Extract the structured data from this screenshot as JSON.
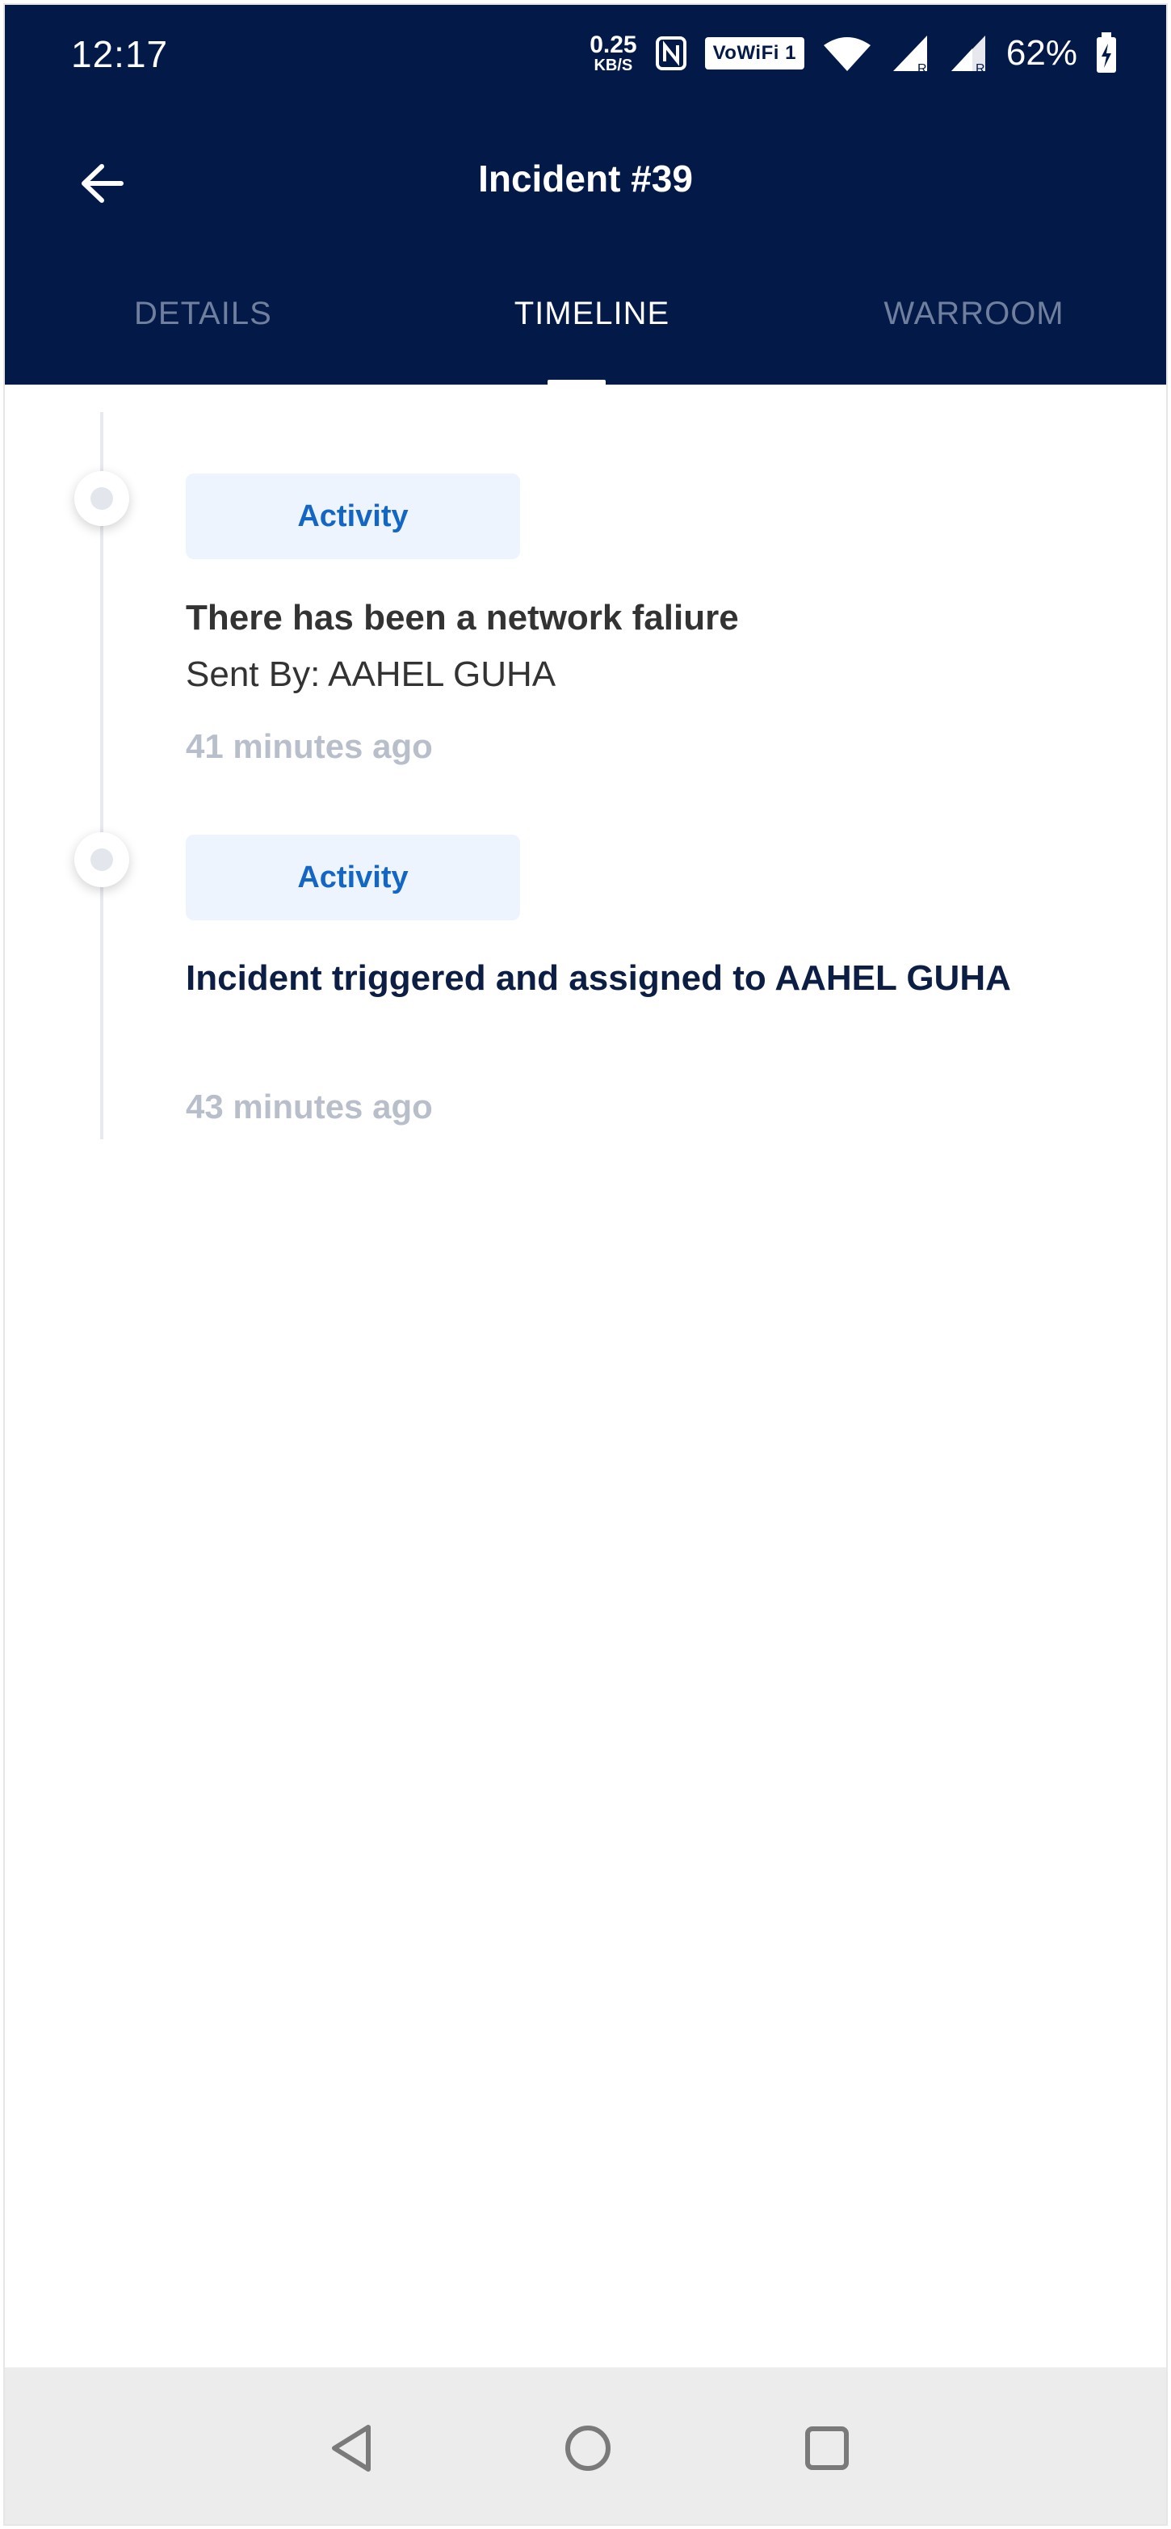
{
  "status_bar": {
    "time": "12:17",
    "net_speed_value": "0.25",
    "net_speed_unit": "KB/S",
    "wifi_badge": "VoWiFi 1",
    "battery": "62%"
  },
  "header": {
    "title": "Incident #39",
    "tabs": [
      {
        "label": "DETAILS"
      },
      {
        "label": "TIMELINE"
      },
      {
        "label": "WARROOM"
      }
    ],
    "active_tab": "TIMELINE",
    "background_color": "#031a48"
  },
  "timeline": [
    {
      "badge": "Activity",
      "title": "There has been a network faliure",
      "sent_by": "Sent By: AAHEL GUHA",
      "time": "41 minutes ago"
    },
    {
      "badge": "Activity",
      "title": "Incident triggered and assigned to AAHEL GUHA",
      "time": "43 minutes ago"
    }
  ],
  "icons": {
    "back": "arrow-left-icon",
    "nfc": "nfc-icon",
    "wifi": "wifi-icon",
    "signal": "signal-icon",
    "battery": "battery-icon",
    "nav_back": "triangle-back-icon",
    "nav_home": "circle-home-icon",
    "nav_recent": "square-recent-icon"
  }
}
